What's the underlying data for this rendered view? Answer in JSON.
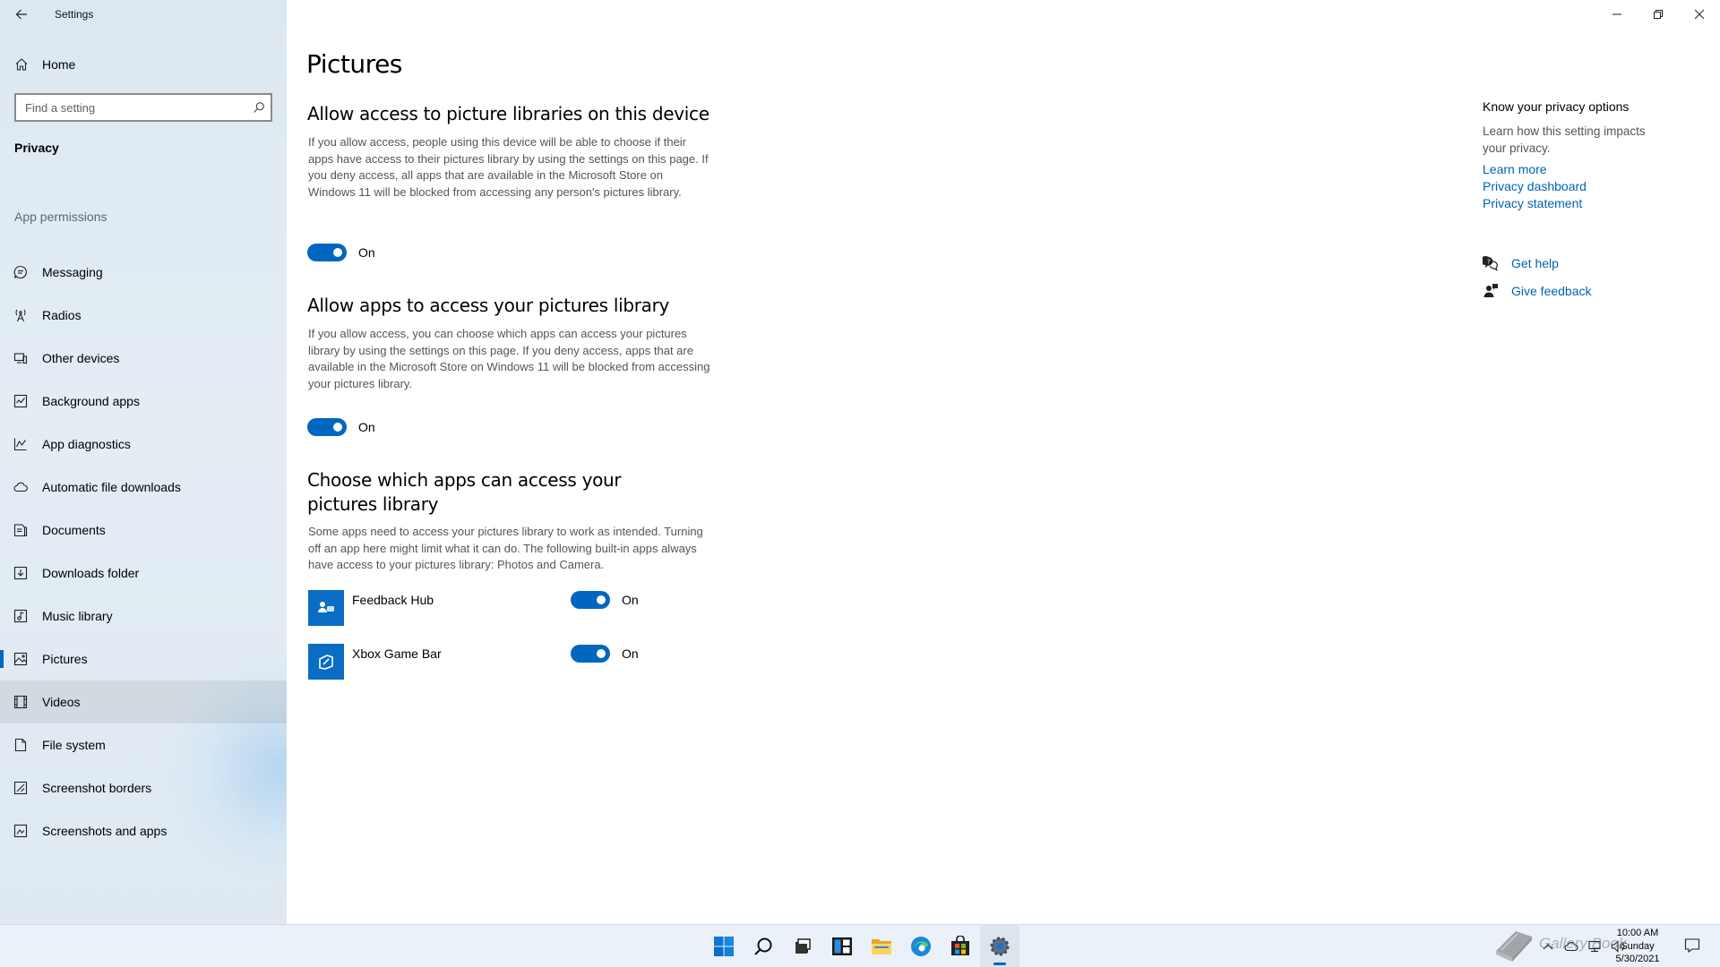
{
  "window": {
    "title": "Settings"
  },
  "sidebar": {
    "home_label": "Home",
    "search_placeholder": "Find a setting",
    "section_title": "Privacy",
    "group_label": "App permissions",
    "items": [
      {
        "label": "Messaging",
        "icon": "messaging-icon"
      },
      {
        "label": "Radios",
        "icon": "radio-tower-icon"
      },
      {
        "label": "Other devices",
        "icon": "devices-icon"
      },
      {
        "label": "Background apps",
        "icon": "background-apps-icon"
      },
      {
        "label": "App diagnostics",
        "icon": "diagnostics-icon"
      },
      {
        "label": "Automatic file downloads",
        "icon": "cloud-download-icon"
      },
      {
        "label": "Documents",
        "icon": "document-icon"
      },
      {
        "label": "Downloads folder",
        "icon": "downloads-folder-icon"
      },
      {
        "label": "Music library",
        "icon": "music-icon"
      },
      {
        "label": "Pictures",
        "icon": "picture-icon"
      },
      {
        "label": "Videos",
        "icon": "video-icon"
      },
      {
        "label": "File system",
        "icon": "file-system-icon"
      },
      {
        "label": "Screenshot borders",
        "icon": "screenshot-border-icon"
      },
      {
        "label": "Screenshots and apps",
        "icon": "screenshot-apps-icon"
      }
    ],
    "selected_item": "Pictures",
    "hovered_item": "Videos"
  },
  "main": {
    "page_title": "Pictures",
    "section1": {
      "heading": "Allow access to picture libraries on this device",
      "description": "If you allow access, people using this device will be able to choose if their apps have access to their pictures library by using the settings on this page. If you deny access, all apps that are available in the Microsoft Store on Windows 11 will be blocked from accessing any person's pictures library.",
      "toggle_state": "On"
    },
    "section2": {
      "heading": "Allow apps to access your pictures library",
      "description": "If you allow access, you can choose which apps can access your pictures library by using the settings on this page. If you deny access, apps that are available in the Microsoft Store on Windows 11 will be blocked from accessing your pictures library.",
      "toggle_state": "On"
    },
    "section3": {
      "heading": "Choose which apps can access your pictures library",
      "description": "Some apps need to access your pictures library to work as intended. Turning off an app here might limit what it can do. The following built-in apps always have access to your pictures library: Photos and Camera.",
      "apps": [
        {
          "name": "Feedback Hub",
          "state": "On",
          "icon": "feedback-hub-icon"
        },
        {
          "name": "Xbox Game Bar",
          "state": "On",
          "icon": "xbox-game-bar-icon"
        }
      ]
    }
  },
  "right_column": {
    "heading": "Know your privacy options",
    "description": "Learn how this setting impacts your privacy.",
    "links": [
      "Learn more",
      "Privacy dashboard",
      "Privacy statement"
    ],
    "get_help": "Get help",
    "give_feedback": "Give feedback"
  },
  "taskbar": {
    "apps": [
      "start-icon",
      "search-icon",
      "task-view-icon",
      "widgets-icon",
      "file-explorer-icon",
      "edge-icon",
      "store-icon",
      "settings-icon"
    ],
    "active_app": "settings-icon",
    "clock_time": "10:00 AM",
    "clock_day": "Sunday",
    "clock_date": "5/30/2021",
    "watermark_text": "Gallery Book"
  },
  "colors": {
    "accent": "#0067c0",
    "link": "#0063b1",
    "sidebar_bg": "#e0eaf2",
    "app_tile": "#0a6cc4"
  }
}
